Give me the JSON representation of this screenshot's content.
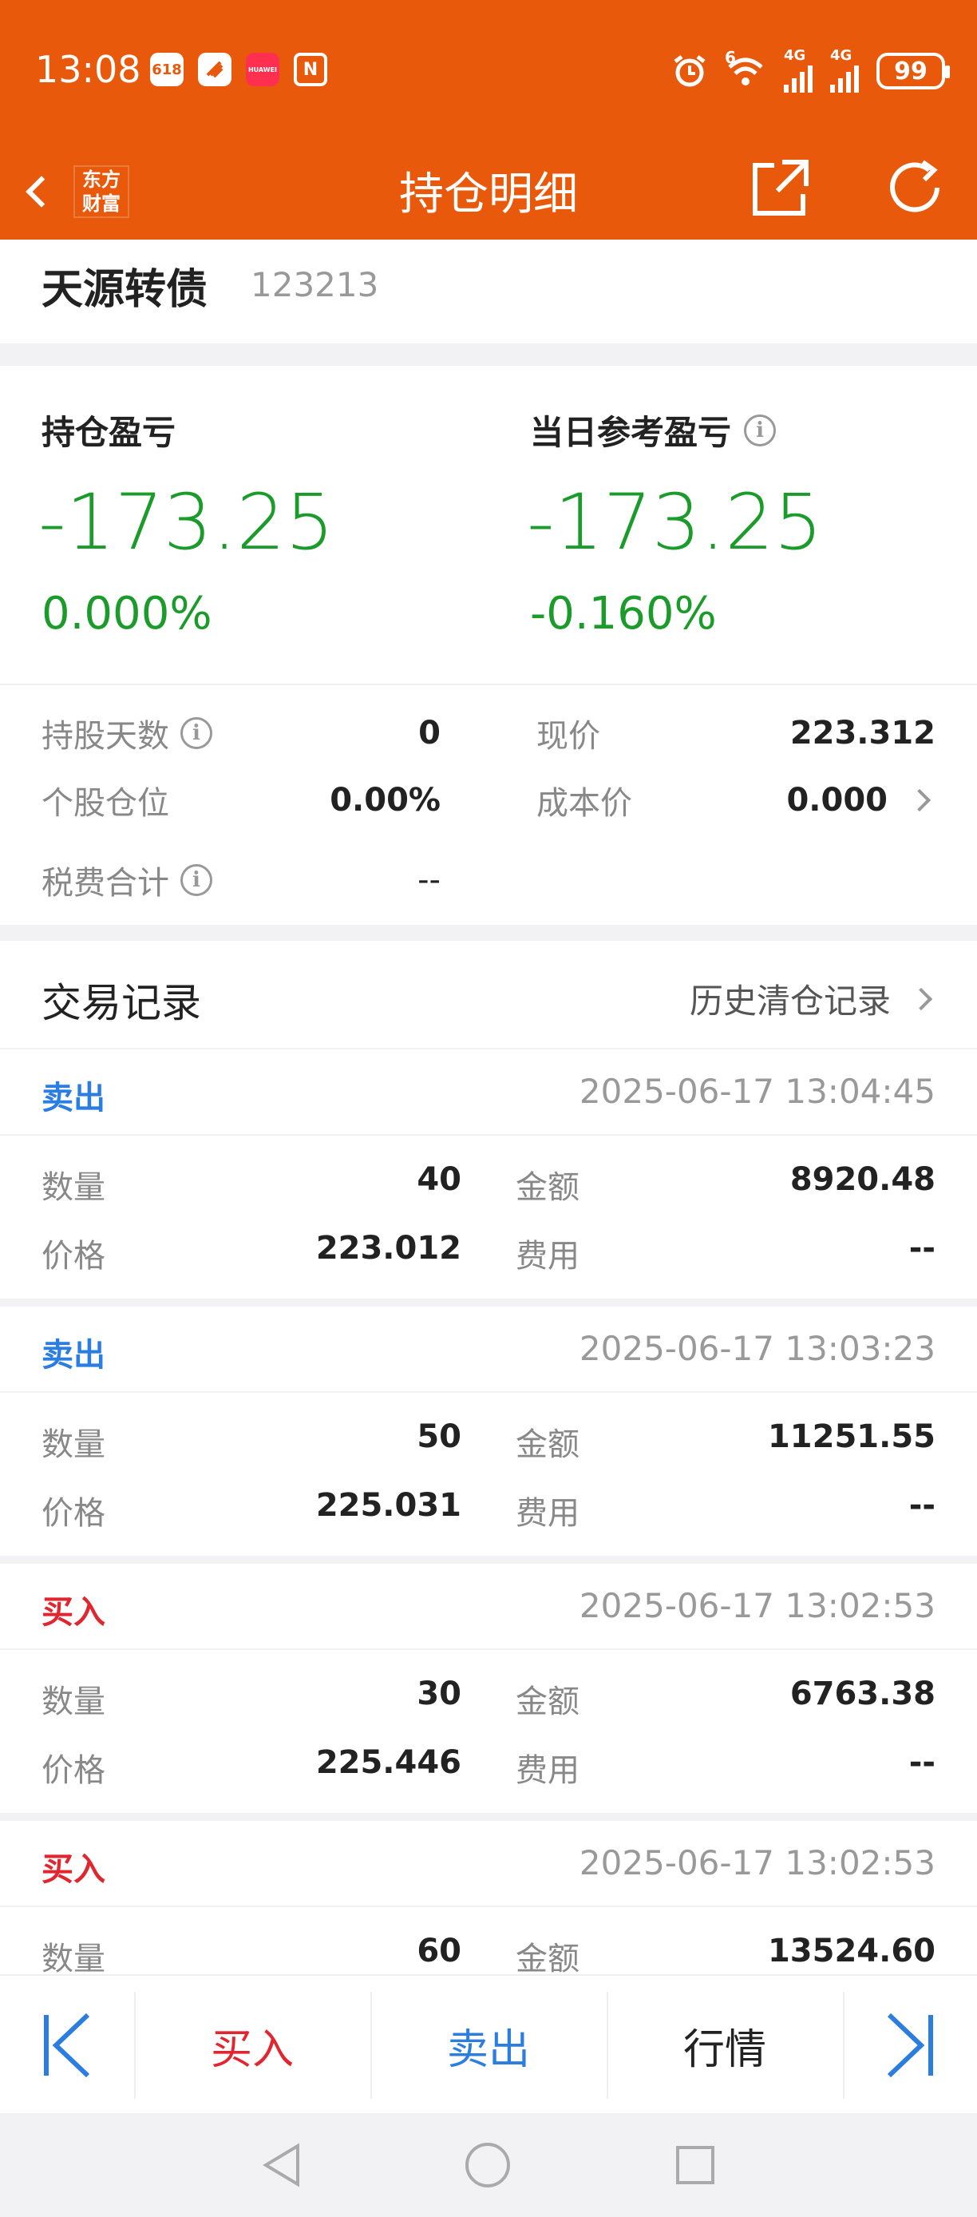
{
  "status_bar": {
    "time": "13:08",
    "network_1": "4G",
    "network_2": "4G",
    "wifi_label": "6",
    "battery": "99",
    "notif_icon_1": "618",
    "notif_icon_2": "HUAWEI"
  },
  "nav": {
    "title": "持仓明细",
    "logo_line1": "东方",
    "logo_line2": "财富"
  },
  "stock": {
    "name": "天源转债",
    "code": "123213"
  },
  "pnl": {
    "position_label": "持仓盈亏",
    "position_value": "-173.25",
    "position_pct": "0.000%",
    "daily_label": "当日参考盈亏",
    "daily_value": "-173.25",
    "daily_pct": "-0.160%"
  },
  "details": {
    "hold_days_label": "持股天数",
    "hold_days": "0",
    "price_label": "现价",
    "price": "223.312",
    "position_ratio_label": "个股仓位",
    "position_ratio": "0.00%",
    "cost_label": "成本价",
    "cost": "0.000",
    "tax_label": "税费合计",
    "tax": "--"
  },
  "trades_header": {
    "title": "交易记录",
    "history_link": "历史清仓记录"
  },
  "trade_labels": {
    "qty": "数量",
    "amount": "金额",
    "price": "价格",
    "fee": "费用"
  },
  "trades": [
    {
      "type": "卖出",
      "time": "2025-06-17 13:04:45",
      "qty": "40",
      "amount": "8920.48",
      "price": "223.012",
      "fee": "--"
    },
    {
      "type": "卖出",
      "time": "2025-06-17 13:03:23",
      "qty": "50",
      "amount": "11251.55",
      "price": "225.031",
      "fee": "--"
    },
    {
      "type": "买入",
      "time": "2025-06-17 13:02:53",
      "qty": "30",
      "amount": "6763.38",
      "price": "225.446",
      "fee": "--"
    },
    {
      "type": "买入",
      "time": "2025-06-17 13:02:53",
      "qty": "60",
      "amount": "13524.60"
    }
  ],
  "toolbar": {
    "buy": "买入",
    "sell": "卖出",
    "quote": "行情"
  },
  "colors": {
    "brand": "#e8590c",
    "loss_green": "#1a9b2a",
    "sell_blue": "#2b7ee0",
    "buy_red": "#e0262f"
  }
}
